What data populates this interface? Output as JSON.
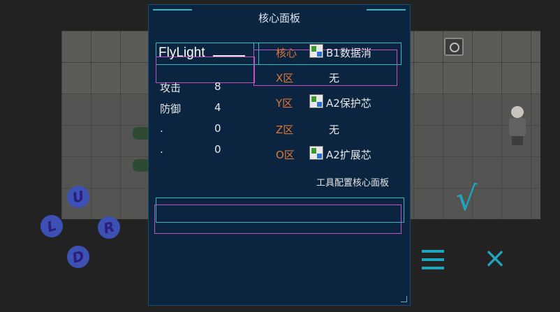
{
  "panel": {
    "title": "核心面板",
    "hero_name": "FlyLight",
    "stats": [
      {
        "label": "攻击",
        "value": "8"
      },
      {
        "label": "防御",
        "value": "4"
      },
      {
        "label": ".",
        "value": "0"
      },
      {
        "label": ".",
        "value": "0"
      }
    ],
    "slots": [
      {
        "key": "核心",
        "item": "B1数据消",
        "has_icon": true
      },
      {
        "key": "X区",
        "item": "无",
        "has_icon": false
      },
      {
        "key": "Y区",
        "item": "A2保护芯",
        "has_icon": true
      },
      {
        "key": "Z区",
        "item": "无",
        "has_icon": false
      },
      {
        "key": "O区",
        "item": "A2扩展芯",
        "has_icon": true
      }
    ],
    "tool_link": "工具配置核心面板"
  },
  "dpad": {
    "up": "U",
    "left": "L",
    "right": "R",
    "down": "D"
  },
  "controls": {
    "confirm": "√",
    "close": "×",
    "menu_icon": "menu-icon"
  },
  "colors": {
    "panel_bg": "#0b2540",
    "accent_cyan": "#30b9c9",
    "accent_magenta": "#c351c5",
    "slot_key": "#e07636",
    "button": "#1ea5bb"
  }
}
